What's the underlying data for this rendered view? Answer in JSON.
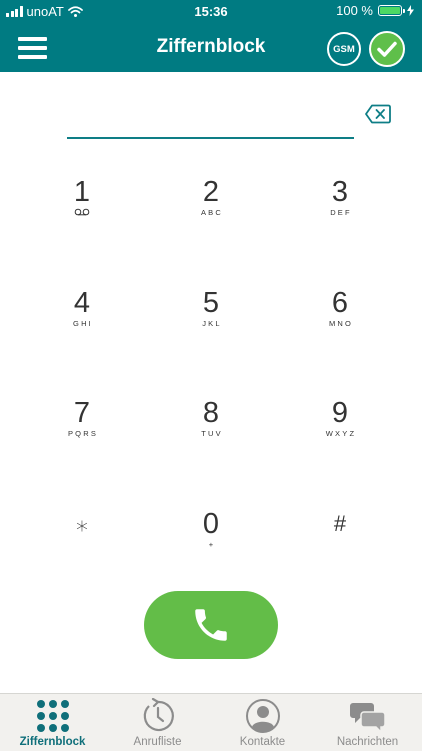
{
  "status_bar": {
    "carrier": "unoAT",
    "time": "15:36",
    "battery": "100 %",
    "battery_level": 1.0
  },
  "header": {
    "title": "Ziffernblock",
    "gsm_label": "GSM",
    "menu_icon": "hamburger-menu-icon",
    "status_icon": "checkmark-circle-icon"
  },
  "dialer": {
    "number_value": "",
    "keys": [
      {
        "digit": "1",
        "letters": "",
        "icon": "voicemail-icon"
      },
      {
        "digit": "2",
        "letters": "ABC"
      },
      {
        "digit": "3",
        "letters": "DEF"
      },
      {
        "digit": "4",
        "letters": "GHI"
      },
      {
        "digit": "5",
        "letters": "JKL"
      },
      {
        "digit": "6",
        "letters": "MNO"
      },
      {
        "digit": "7",
        "letters": "PQRS"
      },
      {
        "digit": "8",
        "letters": "TUV"
      },
      {
        "digit": "9",
        "letters": "WXYZ"
      },
      {
        "digit": "⁎",
        "letters": ""
      },
      {
        "digit": "0",
        "letters": "+"
      },
      {
        "digit": "#",
        "letters": ""
      }
    ]
  },
  "tabs": [
    {
      "label": "Ziffernblock",
      "icon": "keypad-icon",
      "active": true
    },
    {
      "label": "Anrufliste",
      "icon": "history-clock-icon",
      "active": false
    },
    {
      "label": "Kontakte",
      "icon": "contact-person-icon",
      "active": false
    },
    {
      "label": "Nachrichten",
      "icon": "chat-bubbles-icon",
      "active": false
    }
  ],
  "colors": {
    "header": "#007b82",
    "call_button": "#63bd48",
    "status_ok": "#5fbf4a",
    "active_tab": "#0f6f7a",
    "inactive_tab": "#8c8c8c"
  }
}
